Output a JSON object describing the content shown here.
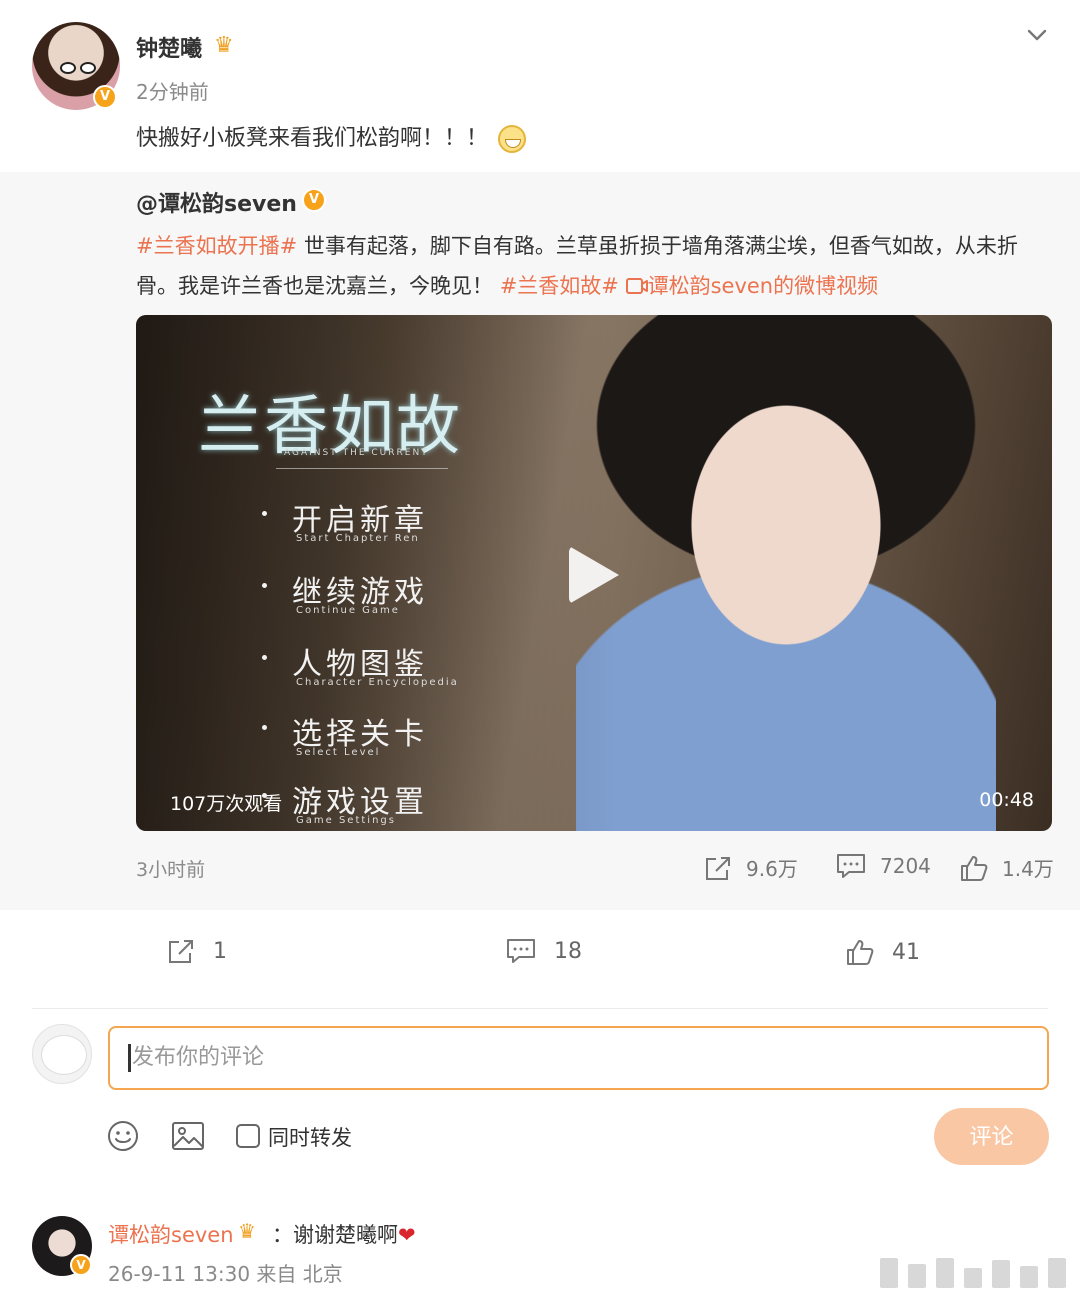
{
  "post": {
    "author": "钟楚曦",
    "time": "2分钟前",
    "text": "快搬好小板凳来看我们松韵啊！！！",
    "verified_badge": "V"
  },
  "repost": {
    "author": "@谭松韵seven",
    "tag1": "#兰香如故开播#",
    "text1": " 世事有起落，脚下自有路。兰草虽折损于墙角落满尘埃，但香气如故，从未折骨。我是许兰香也是沈嘉兰，今晚见！",
    "tag2": "#兰香如故#",
    "video_link": "谭松韵seven的微博视频",
    "video": {
      "title": "兰香如故",
      "subtitle": "AGAINST THE CURRENT",
      "menu": [
        {
          "label": "开启新章",
          "sub": "Start Chapter Ren"
        },
        {
          "label": "继续游戏",
          "sub": "Continue Game"
        },
        {
          "label": "人物图鉴",
          "sub": "Character Encyclopedia"
        },
        {
          "label": "选择关卡",
          "sub": "Select Level"
        },
        {
          "label": "游戏设置",
          "sub": "Game Settings"
        }
      ],
      "views": "107万次观看",
      "duration": "00:48"
    },
    "time": "3小时前",
    "shares": "9.6万",
    "comments": "7204",
    "likes": "1.4万"
  },
  "actions": {
    "shares": "1",
    "comments": "18",
    "likes": "41"
  },
  "comment_box": {
    "placeholder": "发布你的评论",
    "repost_label": "同时转发",
    "submit_label": "评论"
  },
  "comments": [
    {
      "author": "谭松韵seven",
      "text": "：谢谢楚曦啊",
      "heart": "❤",
      "meta": "26-9-11 13:30 来自 北京"
    }
  ],
  "colors": {
    "accent": "#eb7350",
    "input_border": "#f5a64e",
    "submit_bg": "#fac7a5",
    "verified": "#f7a21b"
  }
}
